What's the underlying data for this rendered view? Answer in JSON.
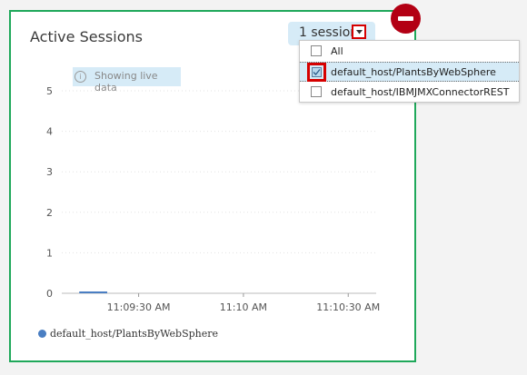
{
  "widget": {
    "title": "Active Sessions",
    "session_button_label": "1 session",
    "info_text": "Showing live data",
    "legend_label": "default_host/PlantsByWebSphere"
  },
  "dropdown": {
    "items": [
      {
        "label": "All",
        "checked": false
      },
      {
        "label": "default_host/PlantsByWebSphere",
        "checked": true
      },
      {
        "label": "default_host/IBMJMXConnectorREST",
        "checked": false
      }
    ]
  },
  "colors": {
    "card_border": "#1fa85a",
    "remove_button": "#b30014",
    "highlight": "#d60000",
    "series": "#4a7ec2",
    "accent_bg": "#d6ebf7"
  },
  "icons": {
    "remove": "minus-circle-icon",
    "info": "info-icon",
    "dropdown": "chevron-down-icon",
    "checkbox": "checkbox-icon"
  },
  "chart_data": {
    "type": "line",
    "title": "Active Sessions",
    "xlabel": "",
    "ylabel": "",
    "ylim": [
      0,
      5
    ],
    "y_ticks": [
      "0",
      "1",
      "2",
      "3",
      "4",
      "5"
    ],
    "x_ticks": [
      "11:09:30 AM",
      "11:10 AM",
      "11:10:30 AM"
    ],
    "series": [
      {
        "name": "default_host/PlantsByWebSphere",
        "x": [
          "11:09:13 AM",
          "11:09:21 AM"
        ],
        "values": [
          0,
          0
        ]
      }
    ],
    "grid": true,
    "legend_position": "bottom-left"
  }
}
